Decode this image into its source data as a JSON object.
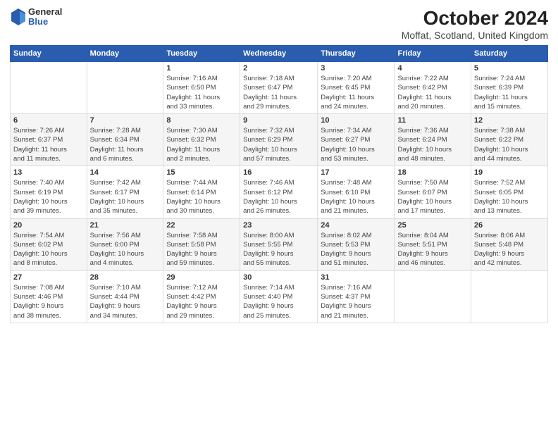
{
  "logo": {
    "general": "General",
    "blue": "Blue"
  },
  "header": {
    "title": "October 2024",
    "subtitle": "Moffat, Scotland, United Kingdom"
  },
  "weekdays": [
    "Sunday",
    "Monday",
    "Tuesday",
    "Wednesday",
    "Thursday",
    "Friday",
    "Saturday"
  ],
  "weeks": [
    [
      {
        "day": "",
        "lines": []
      },
      {
        "day": "",
        "lines": []
      },
      {
        "day": "1",
        "lines": [
          "Sunrise: 7:16 AM",
          "Sunset: 6:50 PM",
          "Daylight: 11 hours",
          "and 33 minutes."
        ]
      },
      {
        "day": "2",
        "lines": [
          "Sunrise: 7:18 AM",
          "Sunset: 6:47 PM",
          "Daylight: 11 hours",
          "and 29 minutes."
        ]
      },
      {
        "day": "3",
        "lines": [
          "Sunrise: 7:20 AM",
          "Sunset: 6:45 PM",
          "Daylight: 11 hours",
          "and 24 minutes."
        ]
      },
      {
        "day": "4",
        "lines": [
          "Sunrise: 7:22 AM",
          "Sunset: 6:42 PM",
          "Daylight: 11 hours",
          "and 20 minutes."
        ]
      },
      {
        "day": "5",
        "lines": [
          "Sunrise: 7:24 AM",
          "Sunset: 6:39 PM",
          "Daylight: 11 hours",
          "and 15 minutes."
        ]
      }
    ],
    [
      {
        "day": "6",
        "lines": [
          "Sunrise: 7:26 AM",
          "Sunset: 6:37 PM",
          "Daylight: 11 hours",
          "and 11 minutes."
        ]
      },
      {
        "day": "7",
        "lines": [
          "Sunrise: 7:28 AM",
          "Sunset: 6:34 PM",
          "Daylight: 11 hours",
          "and 6 minutes."
        ]
      },
      {
        "day": "8",
        "lines": [
          "Sunrise: 7:30 AM",
          "Sunset: 6:32 PM",
          "Daylight: 11 hours",
          "and 2 minutes."
        ]
      },
      {
        "day": "9",
        "lines": [
          "Sunrise: 7:32 AM",
          "Sunset: 6:29 PM",
          "Daylight: 10 hours",
          "and 57 minutes."
        ]
      },
      {
        "day": "10",
        "lines": [
          "Sunrise: 7:34 AM",
          "Sunset: 6:27 PM",
          "Daylight: 10 hours",
          "and 53 minutes."
        ]
      },
      {
        "day": "11",
        "lines": [
          "Sunrise: 7:36 AM",
          "Sunset: 6:24 PM",
          "Daylight: 10 hours",
          "and 48 minutes."
        ]
      },
      {
        "day": "12",
        "lines": [
          "Sunrise: 7:38 AM",
          "Sunset: 6:22 PM",
          "Daylight: 10 hours",
          "and 44 minutes."
        ]
      }
    ],
    [
      {
        "day": "13",
        "lines": [
          "Sunrise: 7:40 AM",
          "Sunset: 6:19 PM",
          "Daylight: 10 hours",
          "and 39 minutes."
        ]
      },
      {
        "day": "14",
        "lines": [
          "Sunrise: 7:42 AM",
          "Sunset: 6:17 PM",
          "Daylight: 10 hours",
          "and 35 minutes."
        ]
      },
      {
        "day": "15",
        "lines": [
          "Sunrise: 7:44 AM",
          "Sunset: 6:14 PM",
          "Daylight: 10 hours",
          "and 30 minutes."
        ]
      },
      {
        "day": "16",
        "lines": [
          "Sunrise: 7:46 AM",
          "Sunset: 6:12 PM",
          "Daylight: 10 hours",
          "and 26 minutes."
        ]
      },
      {
        "day": "17",
        "lines": [
          "Sunrise: 7:48 AM",
          "Sunset: 6:10 PM",
          "Daylight: 10 hours",
          "and 21 minutes."
        ]
      },
      {
        "day": "18",
        "lines": [
          "Sunrise: 7:50 AM",
          "Sunset: 6:07 PM",
          "Daylight: 10 hours",
          "and 17 minutes."
        ]
      },
      {
        "day": "19",
        "lines": [
          "Sunrise: 7:52 AM",
          "Sunset: 6:05 PM",
          "Daylight: 10 hours",
          "and 13 minutes."
        ]
      }
    ],
    [
      {
        "day": "20",
        "lines": [
          "Sunrise: 7:54 AM",
          "Sunset: 6:02 PM",
          "Daylight: 10 hours",
          "and 8 minutes."
        ]
      },
      {
        "day": "21",
        "lines": [
          "Sunrise: 7:56 AM",
          "Sunset: 6:00 PM",
          "Daylight: 10 hours",
          "and 4 minutes."
        ]
      },
      {
        "day": "22",
        "lines": [
          "Sunrise: 7:58 AM",
          "Sunset: 5:58 PM",
          "Daylight: 9 hours",
          "and 59 minutes."
        ]
      },
      {
        "day": "23",
        "lines": [
          "Sunrise: 8:00 AM",
          "Sunset: 5:55 PM",
          "Daylight: 9 hours",
          "and 55 minutes."
        ]
      },
      {
        "day": "24",
        "lines": [
          "Sunrise: 8:02 AM",
          "Sunset: 5:53 PM",
          "Daylight: 9 hours",
          "and 51 minutes."
        ]
      },
      {
        "day": "25",
        "lines": [
          "Sunrise: 8:04 AM",
          "Sunset: 5:51 PM",
          "Daylight: 9 hours",
          "and 46 minutes."
        ]
      },
      {
        "day": "26",
        "lines": [
          "Sunrise: 8:06 AM",
          "Sunset: 5:48 PM",
          "Daylight: 9 hours",
          "and 42 minutes."
        ]
      }
    ],
    [
      {
        "day": "27",
        "lines": [
          "Sunrise: 7:08 AM",
          "Sunset: 4:46 PM",
          "Daylight: 9 hours",
          "and 38 minutes."
        ]
      },
      {
        "day": "28",
        "lines": [
          "Sunrise: 7:10 AM",
          "Sunset: 4:44 PM",
          "Daylight: 9 hours",
          "and 34 minutes."
        ]
      },
      {
        "day": "29",
        "lines": [
          "Sunrise: 7:12 AM",
          "Sunset: 4:42 PM",
          "Daylight: 9 hours",
          "and 29 minutes."
        ]
      },
      {
        "day": "30",
        "lines": [
          "Sunrise: 7:14 AM",
          "Sunset: 4:40 PM",
          "Daylight: 9 hours",
          "and 25 minutes."
        ]
      },
      {
        "day": "31",
        "lines": [
          "Sunrise: 7:16 AM",
          "Sunset: 4:37 PM",
          "Daylight: 9 hours",
          "and 21 minutes."
        ]
      },
      {
        "day": "",
        "lines": []
      },
      {
        "day": "",
        "lines": []
      }
    ]
  ]
}
